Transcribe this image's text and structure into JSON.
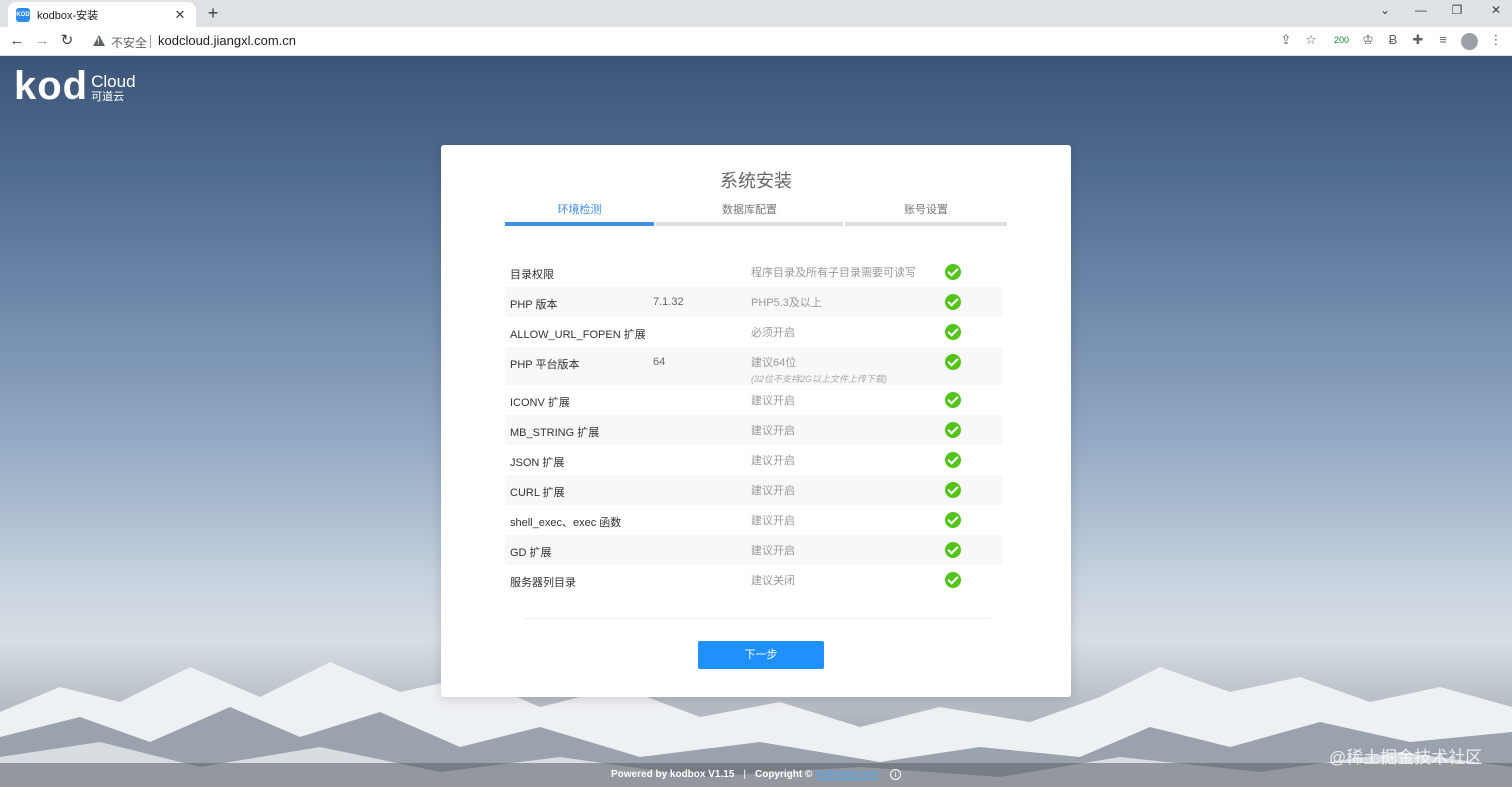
{
  "browser": {
    "tab_title": "kodbox-安装",
    "favicon_text": "KOD",
    "insecure_label": "不安全",
    "url": "kodcloud.jiangxl.com.cn",
    "ext_count": "200"
  },
  "brand": {
    "logo_main": "kod",
    "logo_cloud": "Cloud",
    "logo_cn": "可道云"
  },
  "install": {
    "title": "系统安装",
    "steps": [
      {
        "label": "环境检测",
        "active": true
      },
      {
        "label": "数据库配置",
        "active": false
      },
      {
        "label": "账号设置",
        "active": false
      }
    ],
    "checks": [
      {
        "name": "目录权限",
        "value": "",
        "requirement": "程序目录及所有子目录需要可读写",
        "note": "",
        "ok": true
      },
      {
        "name": "PHP 版本",
        "value": "7.1.32",
        "requirement": "PHP5.3及以上",
        "note": "",
        "ok": true
      },
      {
        "name": "ALLOW_URL_FOPEN 扩展",
        "value": "",
        "requirement": "必须开启",
        "note": "",
        "ok": true
      },
      {
        "name": "PHP 平台版本",
        "value": "64",
        "requirement": "建议64位",
        "note": "(32位不支持2G以上文件上传下载)",
        "ok": true
      },
      {
        "name": "ICONV 扩展",
        "value": "",
        "requirement": "建议开启",
        "note": "",
        "ok": true
      },
      {
        "name": "MB_STRING 扩展",
        "value": "",
        "requirement": "建议开启",
        "note": "",
        "ok": true
      },
      {
        "name": "JSON 扩展",
        "value": "",
        "requirement": "建议开启",
        "note": "",
        "ok": true
      },
      {
        "name": "CURL 扩展",
        "value": "",
        "requirement": "建议开启",
        "note": "",
        "ok": true
      },
      {
        "name": "shell_exec、exec 函数",
        "value": "",
        "requirement": "建议开启",
        "note": "",
        "ok": true
      },
      {
        "name": "GD 扩展",
        "value": "",
        "requirement": "建议开启",
        "note": "",
        "ok": true
      },
      {
        "name": "服务器列目录",
        "value": "",
        "requirement": "建议关闭",
        "note": "",
        "ok": true
      }
    ],
    "next_label": "下一步"
  },
  "footer": {
    "powered": "Powered by kodbox V1.15",
    "separator": "|",
    "copyright": "Copyright ©",
    "link": "kodcloud.com",
    "info_glyph": "i"
  },
  "watermark": "@稀土掘金技术社区",
  "colors": {
    "accent": "#3a8ee6",
    "button": "#1e90ff",
    "ok": "#52c41a"
  }
}
